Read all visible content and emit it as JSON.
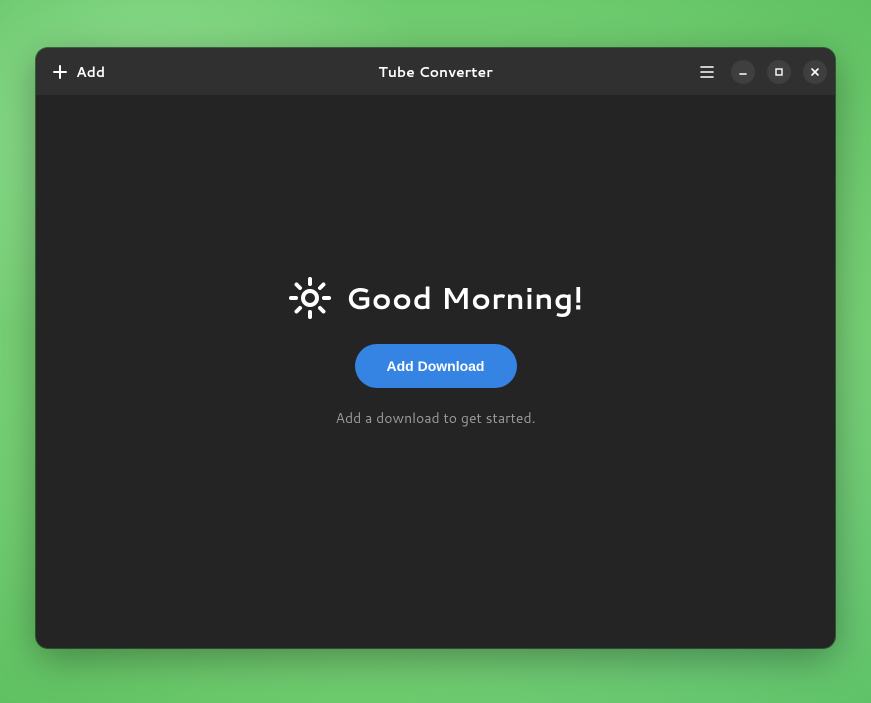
{
  "header": {
    "add_label": "Add",
    "title": "Tube Converter"
  },
  "main": {
    "greeting": "Good Morning!",
    "add_download_label": "Add Download",
    "hint": "Add a download to get started."
  },
  "colors": {
    "accent": "#3584e4",
    "window_bg": "#242424",
    "header_bg": "#303030"
  }
}
